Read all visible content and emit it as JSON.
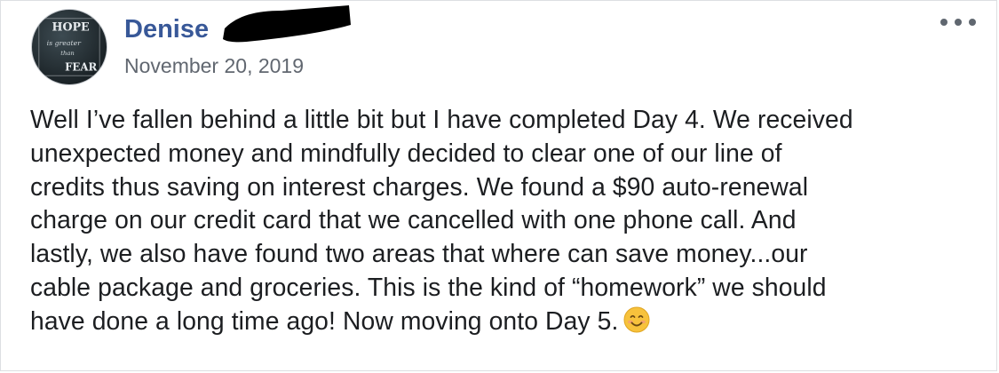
{
  "post": {
    "author": "Denise",
    "timestamp": "November 20, 2019",
    "avatar": {
      "icon": "hope-sign-avatar",
      "lines": [
        "HOPE",
        "is greater",
        "than",
        "FEAR"
      ]
    },
    "menu_icon": "more-options-icon",
    "text_lines": [
      "Well I’ve fallen behind a little bit but I have completed Day 4. We received",
      "unexpected money and mindfully decided to clear one of our line of",
      "credits thus saving on interest charges. We found a $90 auto-renewal",
      "charge on our credit card that we cancelled with one phone call. And",
      "lastly, we also have found two areas that where can save money...our",
      "cable package and groceries. This is the kind of “homework” we should",
      "have done a long time ago! Now moving onto Day 5."
    ],
    "emoji": "smiling-face-emoji"
  },
  "colors": {
    "author": "#385898",
    "timestamp": "#616770",
    "text": "#1c1e21",
    "redaction": "#000000"
  }
}
